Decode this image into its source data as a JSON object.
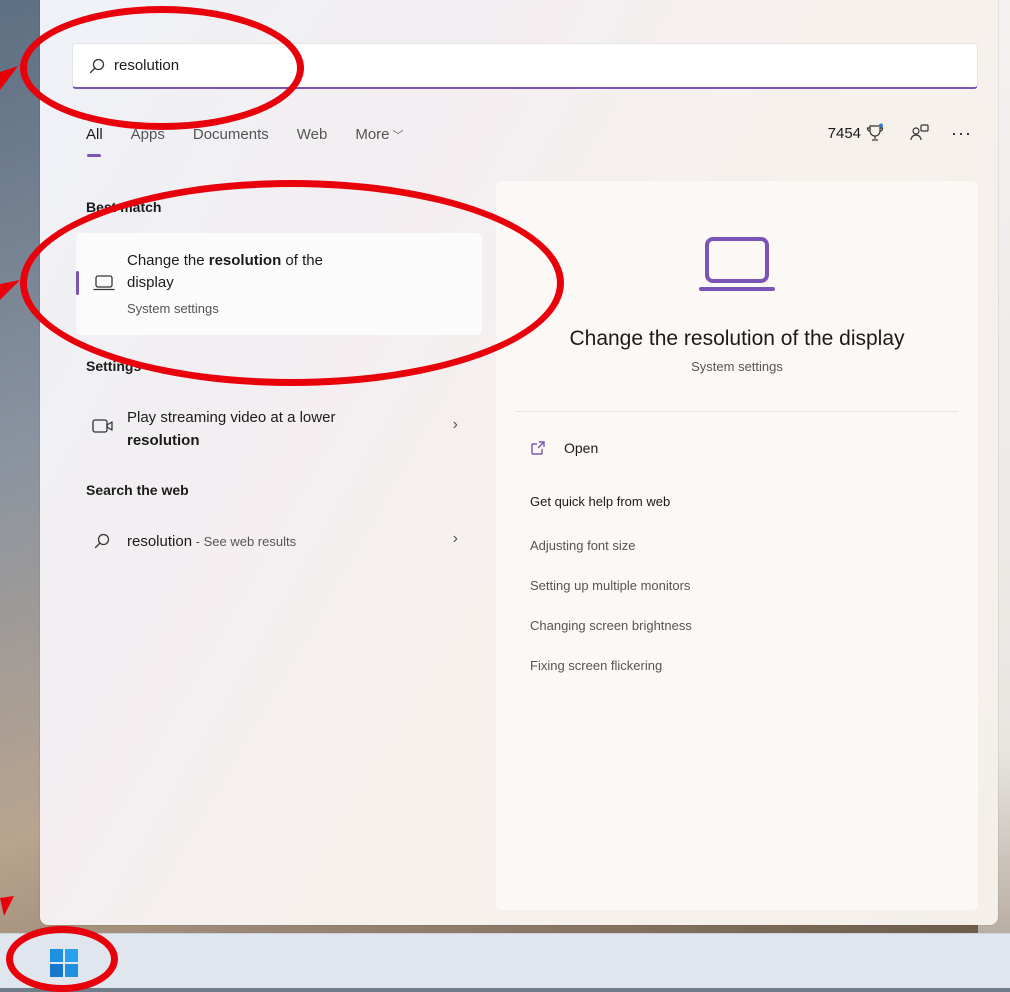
{
  "search": {
    "value": "resolution"
  },
  "tabs": [
    {
      "label": "All"
    },
    {
      "label": "Apps"
    },
    {
      "label": "Documents"
    },
    {
      "label": "Web"
    },
    {
      "label": "More"
    }
  ],
  "header_right": {
    "points": "7454"
  },
  "sections": {
    "best_match": "Best match",
    "settings": "Settings",
    "search_web": "Search the web"
  },
  "best_match": {
    "title_pre": "Change the ",
    "title_bold": "resolution",
    "title_post": " of the",
    "title_line2": "display",
    "subtitle": "System settings"
  },
  "settings_item": {
    "line1": "Play streaming video at a lower",
    "line2": "resolution"
  },
  "web_item": {
    "query": "resolution",
    "suffix": " - See web results"
  },
  "detail": {
    "title": "Change the resolution of the display",
    "subtitle": "System settings",
    "open_label": "Open",
    "help_title": "Get quick help from web",
    "help_links": [
      "Adjusting font size",
      "Setting up multiple monitors",
      "Changing screen brightness",
      "Fixing screen flickering"
    ]
  },
  "colors": {
    "accent": "#7a55b5",
    "annotation": "#e8000b"
  }
}
